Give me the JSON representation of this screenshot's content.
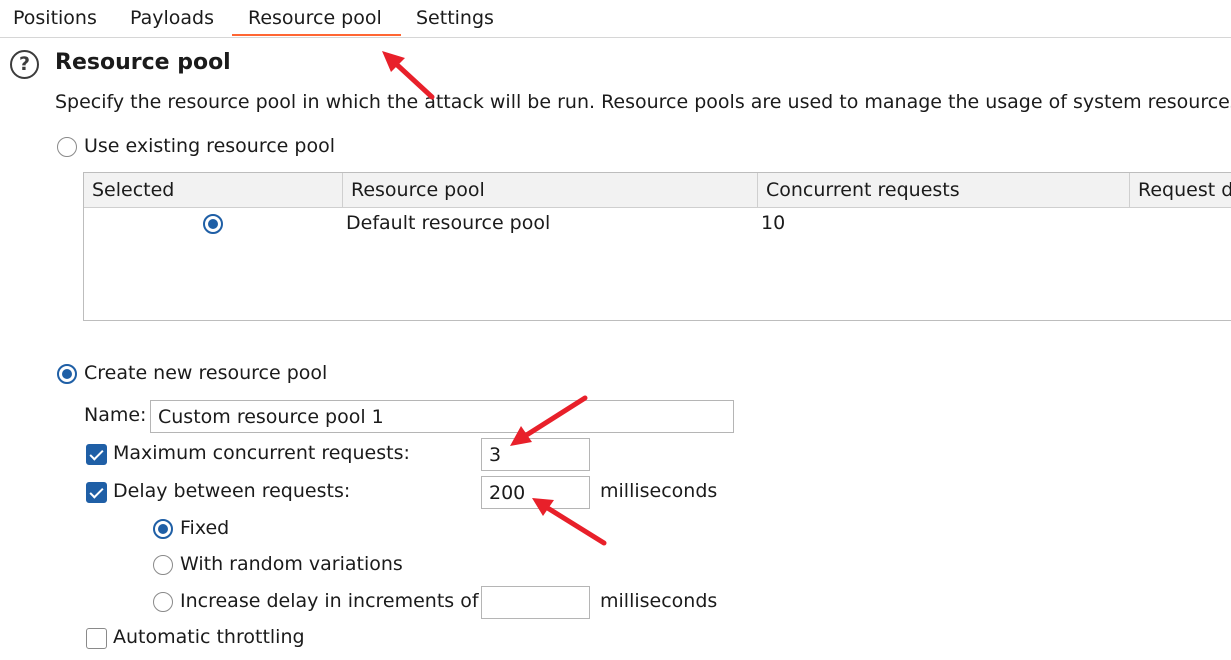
{
  "tabs": [
    {
      "label": "Positions"
    },
    {
      "label": "Payloads"
    },
    {
      "label": "Resource pool"
    },
    {
      "label": "Settings"
    }
  ],
  "active_tab": "Resource pool",
  "help_icon": "help-icon",
  "help_glyph": "?",
  "section": {
    "title": "Resource pool",
    "description": "Specify the resource pool in which the attack will be run. Resource pools are used to manage the usage of system resources"
  },
  "existing_pool": {
    "label": "Use existing resource pool",
    "selected": false,
    "table": {
      "columns": [
        "Selected",
        "Resource pool",
        "Concurrent requests",
        "Request d"
      ],
      "rows": [
        {
          "selected": true,
          "name": "Default resource pool",
          "concurrent": "10",
          "delay": ""
        }
      ]
    }
  },
  "new_pool": {
    "label": "Create new resource pool",
    "selected": true,
    "name_label": "Name:",
    "name_value": "Custom resource pool 1",
    "max_concurrent": {
      "label": "Maximum concurrent requests:",
      "checked": true,
      "value": "3"
    },
    "delay": {
      "label": "Delay between requests:",
      "checked": true,
      "value": "200",
      "unit": "milliseconds",
      "options": [
        {
          "label": "Fixed",
          "selected": true
        },
        {
          "label": "With random variations",
          "selected": false
        },
        {
          "label": "Increase delay in increments of",
          "selected": false,
          "value": "",
          "unit": "milliseconds"
        }
      ]
    },
    "throttling": {
      "label": "Automatic throttling",
      "checked": false
    }
  },
  "colors": {
    "accent": "#1f5fa6",
    "tab_underline": "#ff6633",
    "annotation_arrow": "#e8202a"
  }
}
